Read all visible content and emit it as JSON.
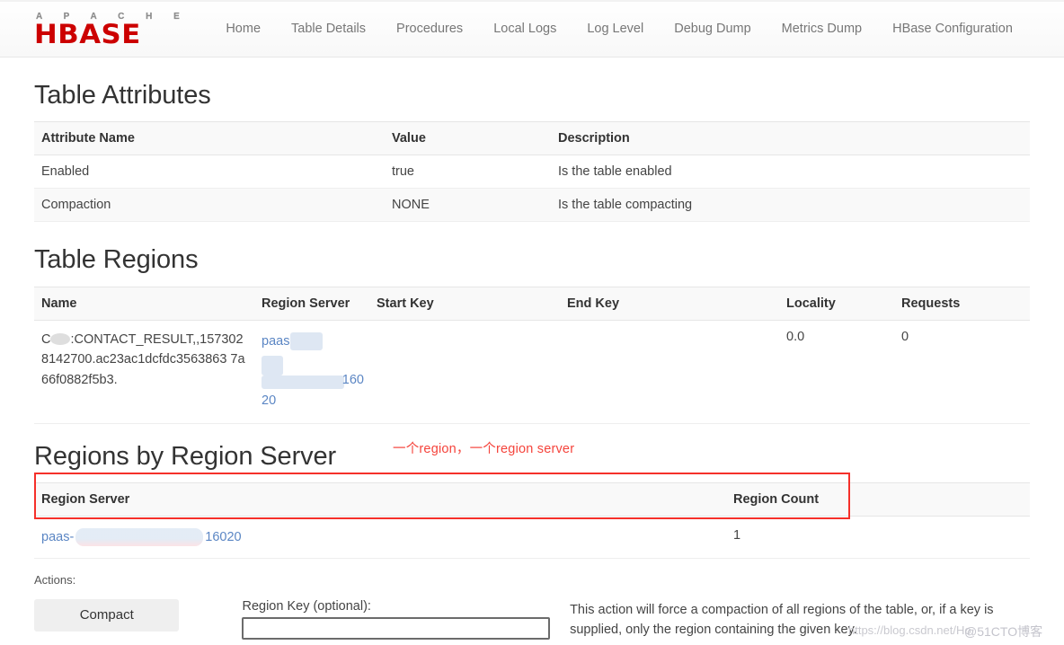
{
  "brand": {
    "top": "A P A C H E",
    "main": "HBASE"
  },
  "nav": {
    "items": [
      {
        "label": "Home"
      },
      {
        "label": "Table Details"
      },
      {
        "label": "Procedures"
      },
      {
        "label": "Local Logs"
      },
      {
        "label": "Log Level"
      },
      {
        "label": "Debug Dump"
      },
      {
        "label": "Metrics Dump"
      },
      {
        "label": "HBase Configuration"
      }
    ]
  },
  "table_attributes": {
    "title": "Table Attributes",
    "headers": [
      "Attribute Name",
      "Value",
      "Description"
    ],
    "rows": [
      {
        "name": "Enabled",
        "value": "true",
        "description": "Is the table enabled"
      },
      {
        "name": "Compaction",
        "value": "NONE",
        "description": "Is the table compacting"
      }
    ]
  },
  "table_regions": {
    "title": "Table Regions",
    "headers": [
      "Name",
      "Region Server",
      "Start Key",
      "End Key",
      "Locality",
      "Requests"
    ],
    "rows": [
      {
        "name_prefix": "C",
        "name_rest": ":CONTACT_RESULT,,157302814 2700.ac23ac1dcfdc35638637a66f0882f5b3.",
        "name_full": "C[redacted]:CONTACT_RESULT,,1573028142700.ac23ac1dcfdc35638637a66f0882f5b3.",
        "region_server_prefix": "paas",
        "region_server_port_a": "160",
        "region_server_port_b": "20",
        "start_key": "",
        "end_key": "",
        "locality": "0.0",
        "requests": "0"
      }
    ]
  },
  "regions_by_region_server": {
    "title": "Regions by Region Server",
    "headers": [
      "Region Server",
      "Region Count"
    ],
    "rows": [
      {
        "server_prefix": "paas-",
        "server_port": "16020",
        "region_count": "1"
      }
    ]
  },
  "annotation": {
    "text": "一个region，一个region server",
    "color": "#f5443c"
  },
  "actions": {
    "label": "Actions:",
    "compact_button": "Compact",
    "region_key_label": "Region Key (optional):",
    "region_key_value": "",
    "region_key_placeholder": "",
    "description": "This action will force a compaction of all regions of the table, or, if a key is supplied, only the region containing the given key."
  },
  "watermarks": {
    "url": "https://blog.csdn.net/Ho",
    "site": "@51CTO博客"
  }
}
